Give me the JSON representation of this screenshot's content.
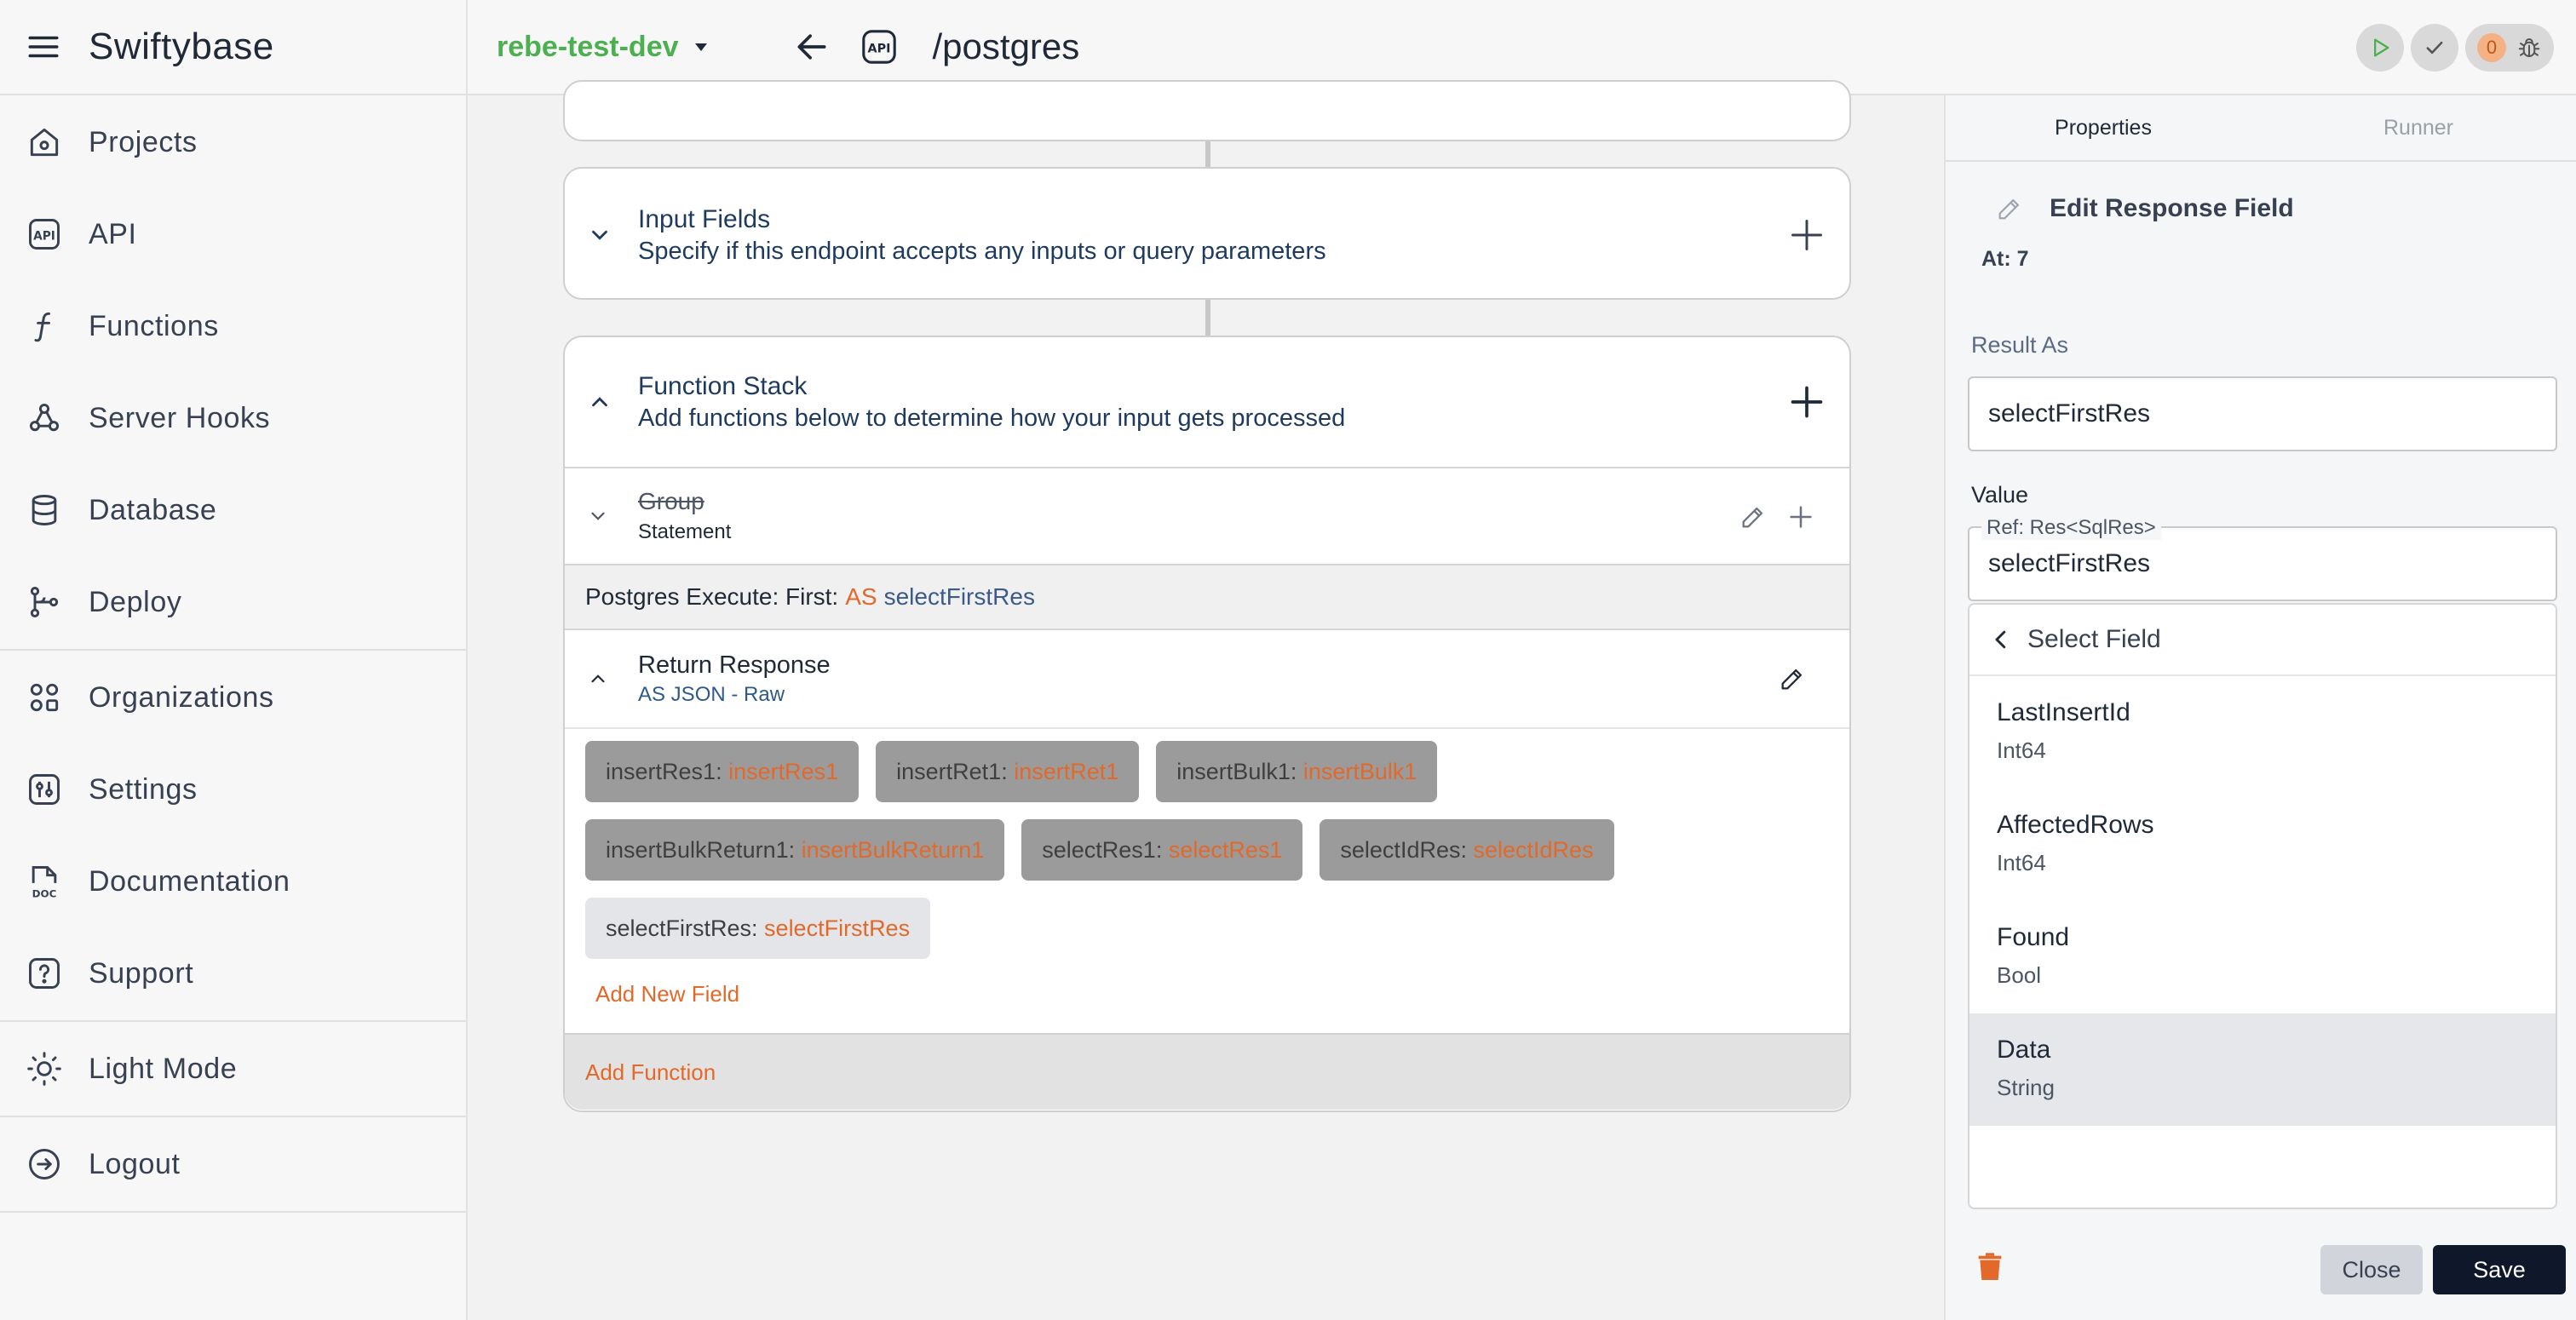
{
  "app": {
    "name": "Swiftybase"
  },
  "sidebar": {
    "groups": [
      [
        {
          "label": "Projects",
          "icon": "home-icon"
        },
        {
          "label": "API",
          "icon": "api-icon"
        },
        {
          "label": "Functions",
          "icon": "function-icon"
        },
        {
          "label": "Server Hooks",
          "icon": "webhook-icon"
        },
        {
          "label": "Database",
          "icon": "database-icon"
        },
        {
          "label": "Deploy",
          "icon": "git-branch-icon"
        }
      ],
      [
        {
          "label": "Organizations",
          "icon": "organizations-icon"
        },
        {
          "label": "Settings",
          "icon": "settings-icon"
        },
        {
          "label": "Documentation",
          "icon": "document-icon"
        },
        {
          "label": "Support",
          "icon": "help-icon"
        }
      ],
      [
        {
          "label": "Light Mode",
          "icon": "sun-icon"
        }
      ],
      [
        {
          "label": "Logout",
          "icon": "logout-icon"
        }
      ]
    ]
  },
  "header": {
    "project": "rebe-test-dev",
    "api_badge": "API",
    "path": "/postgres",
    "error_count": "0",
    "colors": {
      "project": "#4caf50",
      "run": "#4caf50"
    }
  },
  "main": {
    "input_fields": {
      "title": "Input Fields",
      "subtitle": "Specify if this endpoint accepts any inputs or query parameters"
    },
    "function_stack": {
      "title": "Function Stack",
      "subtitle": "Add functions below to determine how your input gets processed",
      "group": {
        "title": "Group",
        "subtitle": "Statement"
      },
      "exec": {
        "prefix": "Postgres Execute: First:",
        "as": "AS",
        "ref": "selectFirstRes"
      },
      "return_response": {
        "title": "Return Response",
        "subtitle": "AS JSON - Raw"
      },
      "chips": [
        [
          {
            "key": "insertRes1",
            "value": "insertRes1"
          },
          {
            "key": "insertRet1",
            "value": "insertRet1"
          },
          {
            "key": "insertBulk1",
            "value": "insertBulk1"
          }
        ],
        [
          {
            "key": "insertBulkReturn1",
            "value": "insertBulkReturn1"
          },
          {
            "key": "selectRes1",
            "value": "selectRes1"
          },
          {
            "key": "selectIdRes",
            "value": "selectIdRes"
          }
        ],
        [
          {
            "key": "selectFirstRes",
            "value": "selectFirstRes",
            "active": true
          }
        ]
      ],
      "add_field": "Add New Field",
      "add_function": "Add Function"
    },
    "accent": "#e2692a"
  },
  "panel": {
    "tabs": [
      "Properties",
      "Runner"
    ],
    "title": "Edit Response Field",
    "at": "At: 7",
    "result_as_label": "Result As",
    "result_as_value": "selectFirstRes",
    "value_label": "Value",
    "value_legend": "Ref: Res<SqlRes>",
    "value_value": "selectFirstRes",
    "dropdown": {
      "header": "Select Field",
      "items": [
        {
          "name": "LastInsertId",
          "type": "Int64"
        },
        {
          "name": "AffectedRows",
          "type": "Int64"
        },
        {
          "name": "Found",
          "type": "Bool"
        },
        {
          "name": "Data",
          "type": "String",
          "selected": true
        }
      ]
    },
    "close_label": "Close",
    "save_label": "Save"
  }
}
